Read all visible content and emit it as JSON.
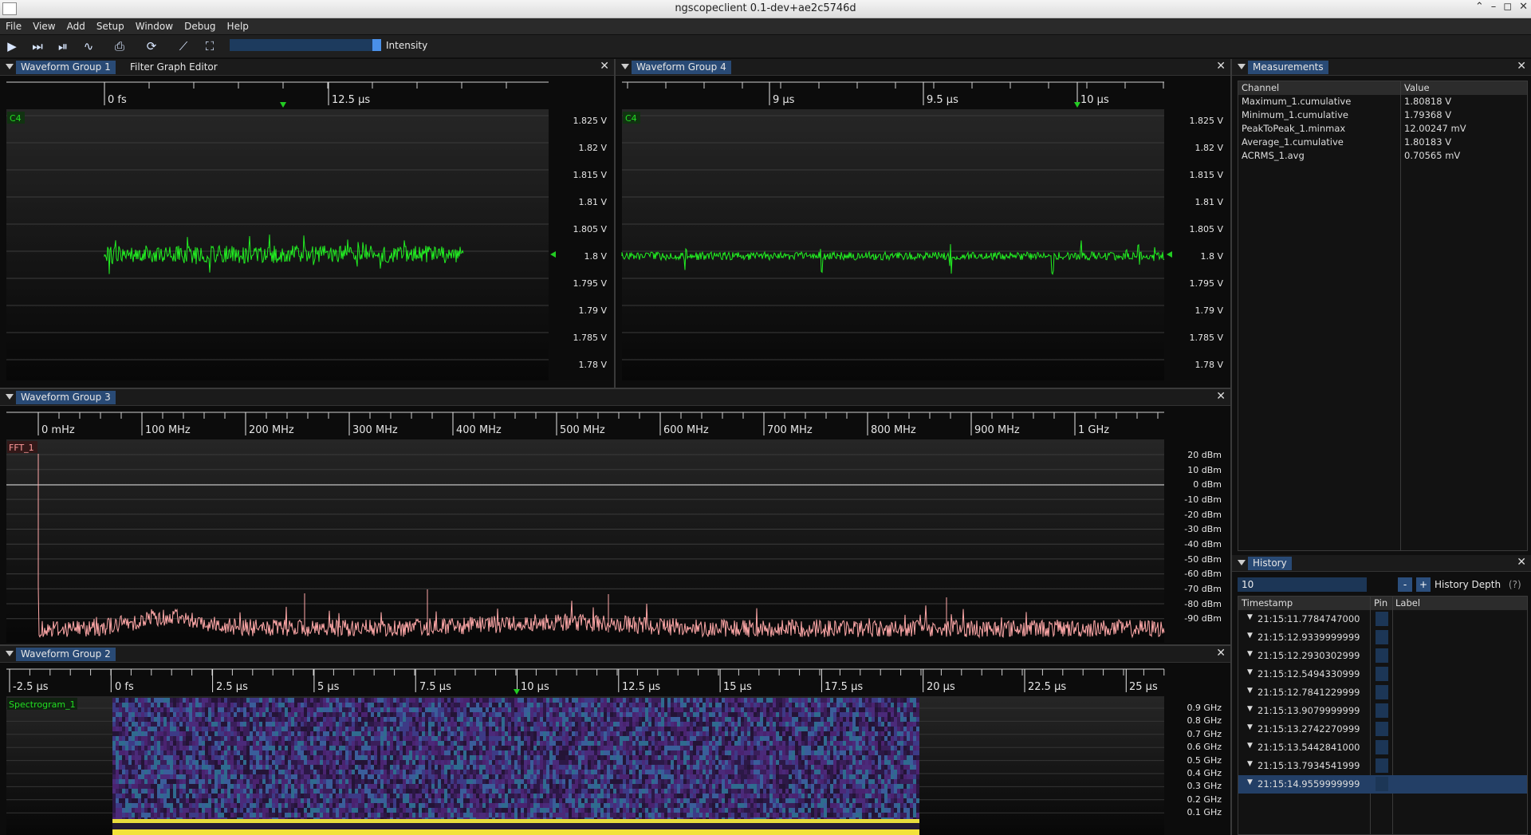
{
  "window": {
    "title": "ngscopeclient 0.1-dev+ae2c5746d"
  },
  "menu": [
    "File",
    "View",
    "Add",
    "Setup",
    "Window",
    "Debug",
    "Help"
  ],
  "toolbar": {
    "icons": [
      "play-icon",
      "play-step-icon",
      "play-single-icon",
      "waveform-icon",
      "instrument-icon",
      "refresh-icon",
      "chart-icon",
      "fullscreen-icon"
    ],
    "intensity_label": "Intensity",
    "intensity": 0.95
  },
  "panels": {
    "wg1": {
      "tabs": [
        "Waveform Group 1",
        "Filter Graph Editor"
      ],
      "channel": "C4",
      "x_ticks": [
        "0 fs",
        "12.5 µs"
      ],
      "y_labels": [
        "1.825 V",
        "1.82 V",
        "1.815 V",
        "1.81 V",
        "1.805 V",
        "1.8 V",
        "1.795 V",
        "1.79 V",
        "1.785 V",
        "1.78 V"
      ]
    },
    "wg4": {
      "tabs": [
        "Waveform Group 4"
      ],
      "channel": "C4",
      "x_ticks": [
        "9 µs",
        "9.5 µs",
        "10 µs"
      ],
      "y_labels": [
        "1.825 V",
        "1.82 V",
        "1.815 V",
        "1.81 V",
        "1.805 V",
        "1.8 V",
        "1.795 V",
        "1.79 V",
        "1.785 V",
        "1.78 V"
      ]
    },
    "wg3": {
      "tabs": [
        "Waveform Group 3"
      ],
      "channel": "FFT_1",
      "x_ticks": [
        "0 mHz",
        "100 MHz",
        "200 MHz",
        "300 MHz",
        "400 MHz",
        "500 MHz",
        "600 MHz",
        "700 MHz",
        "800 MHz",
        "900 MHz",
        "1 GHz"
      ],
      "y_labels": [
        "20 dBm",
        "10 dBm",
        "0 dBm",
        "-10 dBm",
        "-20 dBm",
        "-30 dBm",
        "-40 dBm",
        "-50 dBm",
        "-60 dBm",
        "-70 dBm",
        "-80 dBm",
        "-90 dBm"
      ]
    },
    "wg2": {
      "tabs": [
        "Waveform Group 2"
      ],
      "channel": "Spectrogram_1",
      "x_ticks": [
        "-2.5 µs",
        "0 fs",
        "2.5 µs",
        "5 µs",
        "7.5 µs",
        "10 µs",
        "12.5 µs",
        "15 µs",
        "17.5 µs",
        "20 µs",
        "22.5 µs",
        "25 µs"
      ],
      "y_labels": [
        "0.9 GHz",
        "0.8 GHz",
        "0.7 GHz",
        "0.6 GHz",
        "0.5 GHz",
        "0.4 GHz",
        "0.3 GHz",
        "0.2 GHz",
        "0.1 GHz"
      ]
    }
  },
  "measurements": {
    "title": "Measurements",
    "headers": [
      "Channel",
      "Value"
    ],
    "rows": [
      {
        "channel": "Maximum_1.cumulative",
        "value": "1.80818 V"
      },
      {
        "channel": "Minimum_1.cumulative",
        "value": "1.79368 V"
      },
      {
        "channel": "PeakToPeak_1.minmax",
        "value": "12.00247 mV"
      },
      {
        "channel": "Average_1.cumulative",
        "value": "1.80183 V"
      },
      {
        "channel": "ACRMS_1.avg",
        "value": "0.70565 mV"
      }
    ]
  },
  "history": {
    "title": "History",
    "depth_value": "10",
    "minus": "-",
    "plus": "+",
    "depth_label": "History Depth",
    "help": "(?)",
    "headers": [
      "Timestamp",
      "Pin",
      "Label"
    ],
    "rows": [
      "21:15:11.7784747000",
      "21:15:12.9339999999",
      "21:15:12.2930302999",
      "21:15:12.5494330999",
      "21:15:12.7841229999",
      "21:15:13.9079999999",
      "21:15:13.2742270999",
      "21:15:13.5442841000",
      "21:15:13.7934541999",
      "21:15:14.9559999999"
    ]
  },
  "colors": {
    "trace_green": "#22ee22",
    "fft_pink": "#ffa8a8",
    "accent_blue": "#294a75"
  }
}
